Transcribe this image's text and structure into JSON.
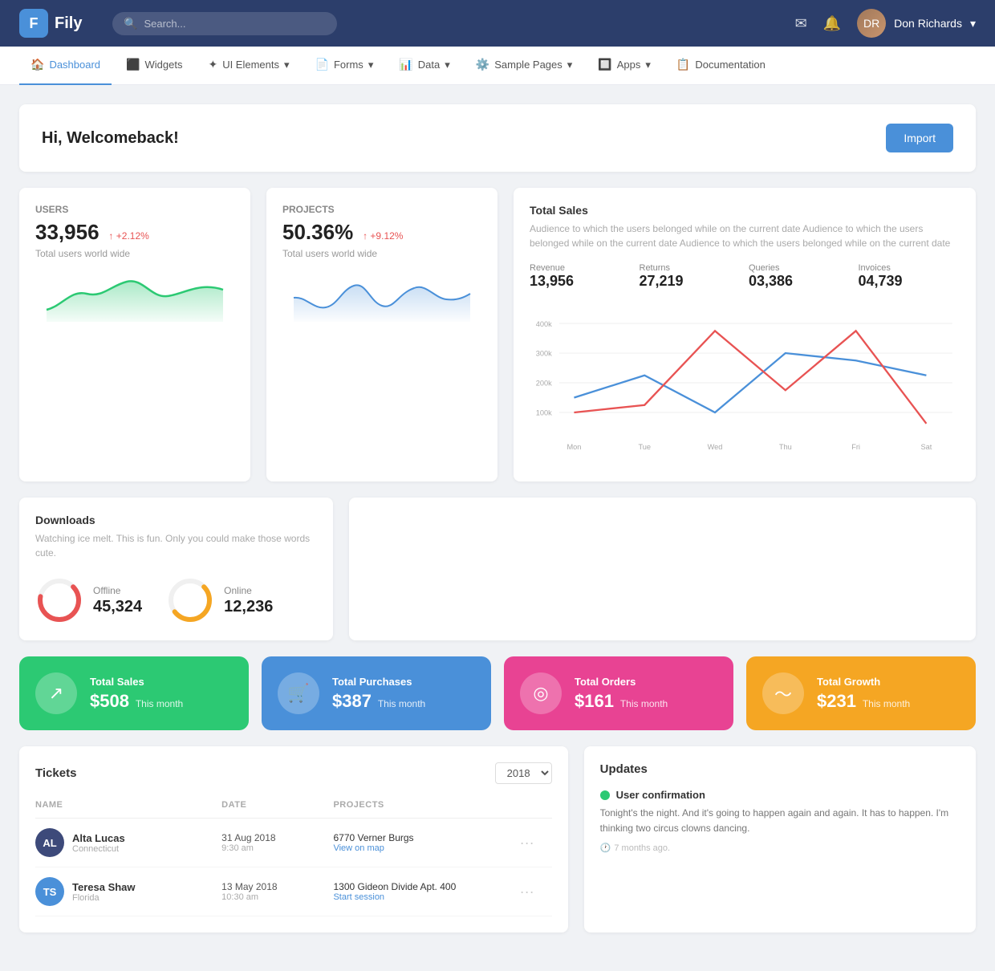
{
  "header": {
    "logo_letter": "F",
    "app_name": "Fily",
    "search_placeholder": "Search...",
    "user_name": "Don Richards"
  },
  "nav": {
    "items": [
      {
        "label": "Dashboard",
        "icon": "🏠",
        "active": true
      },
      {
        "label": "Widgets",
        "icon": "⬛"
      },
      {
        "label": "UI Elements",
        "icon": "✦",
        "has_arrow": true
      },
      {
        "label": "Forms",
        "icon": "📄",
        "has_arrow": true
      },
      {
        "label": "Data",
        "icon": "📊",
        "has_arrow": true
      },
      {
        "label": "Sample Pages",
        "icon": "⚙️",
        "has_arrow": true
      },
      {
        "label": "Apps",
        "icon": "🔲",
        "has_arrow": true
      },
      {
        "label": "Documentation",
        "icon": "📋"
      }
    ]
  },
  "welcome": {
    "title": "Hi, Welcomeback!",
    "import_label": "Import"
  },
  "users_card": {
    "label": "Users",
    "value": "33,956",
    "change": "+2.12%",
    "sub": "Total users world wide"
  },
  "projects_card": {
    "label": "Projects",
    "value": "50.36%",
    "change": "+9.12%",
    "sub": "Total users world wide"
  },
  "total_sales": {
    "title": "Total Sales",
    "desc": "Audience to which the users belonged while on the current date Audience to which the users belonged while on the current date Audience to which the users belonged while on the current date",
    "metrics": [
      {
        "label": "Revenue",
        "value": "13,956"
      },
      {
        "label": "Returns",
        "value": "27,219"
      },
      {
        "label": "Queries",
        "value": "03,386"
      },
      {
        "label": "Invoices",
        "value": "04,739"
      }
    ],
    "chart_labels": [
      "Mon",
      "Tue",
      "Wed",
      "Thu",
      "Fri",
      "Sat"
    ],
    "chart_y_labels": [
      "400k",
      "300k",
      "200k",
      "100k"
    ]
  },
  "downloads": {
    "title": "Downloads",
    "desc": "Watching ice melt. This is fun. Only you could make those words cute.",
    "offline_label": "Offline",
    "offline_value": "45,324",
    "online_label": "Online",
    "online_value": "12,236"
  },
  "summary_cards": [
    {
      "title": "Total Sales",
      "value": "$508",
      "period": "This month",
      "color": "green",
      "icon": "↗"
    },
    {
      "title": "Total Purchases",
      "value": "$387",
      "period": "This month",
      "color": "blue",
      "icon": "🛒"
    },
    {
      "title": "Total Orders",
      "value": "$161",
      "period": "This month",
      "color": "pink",
      "icon": "⊙"
    },
    {
      "title": "Total Growth",
      "value": "$231",
      "period": "This month",
      "color": "orange",
      "icon": "📈"
    }
  ],
  "tickets": {
    "title": "Tickets",
    "year": "2018",
    "columns": [
      "NAME",
      "DATE",
      "PROJECTS"
    ],
    "rows": [
      {
        "initials": "AL",
        "color": "#3d4a7a",
        "name": "Alta Lucas",
        "location": "Connecticut",
        "date": "31 Aug 2018",
        "time": "9:30 am",
        "project": "6770 Verner Burgs",
        "link": "View on map"
      },
      {
        "initials": "TS",
        "color": "#4a90d9",
        "name": "Teresa Shaw",
        "location": "Florida",
        "date": "13 May 2018",
        "time": "10:30 am",
        "project": "1300 Gideon Divide Apt. 400",
        "link": "Start session"
      }
    ]
  },
  "updates": {
    "title": "Updates",
    "item": {
      "heading": "User confirmation",
      "text": "Tonight's the night. And it's going to happen again and again. It has to happen. I'm thinking two circus clowns dancing.",
      "time": "7 months ago."
    }
  }
}
